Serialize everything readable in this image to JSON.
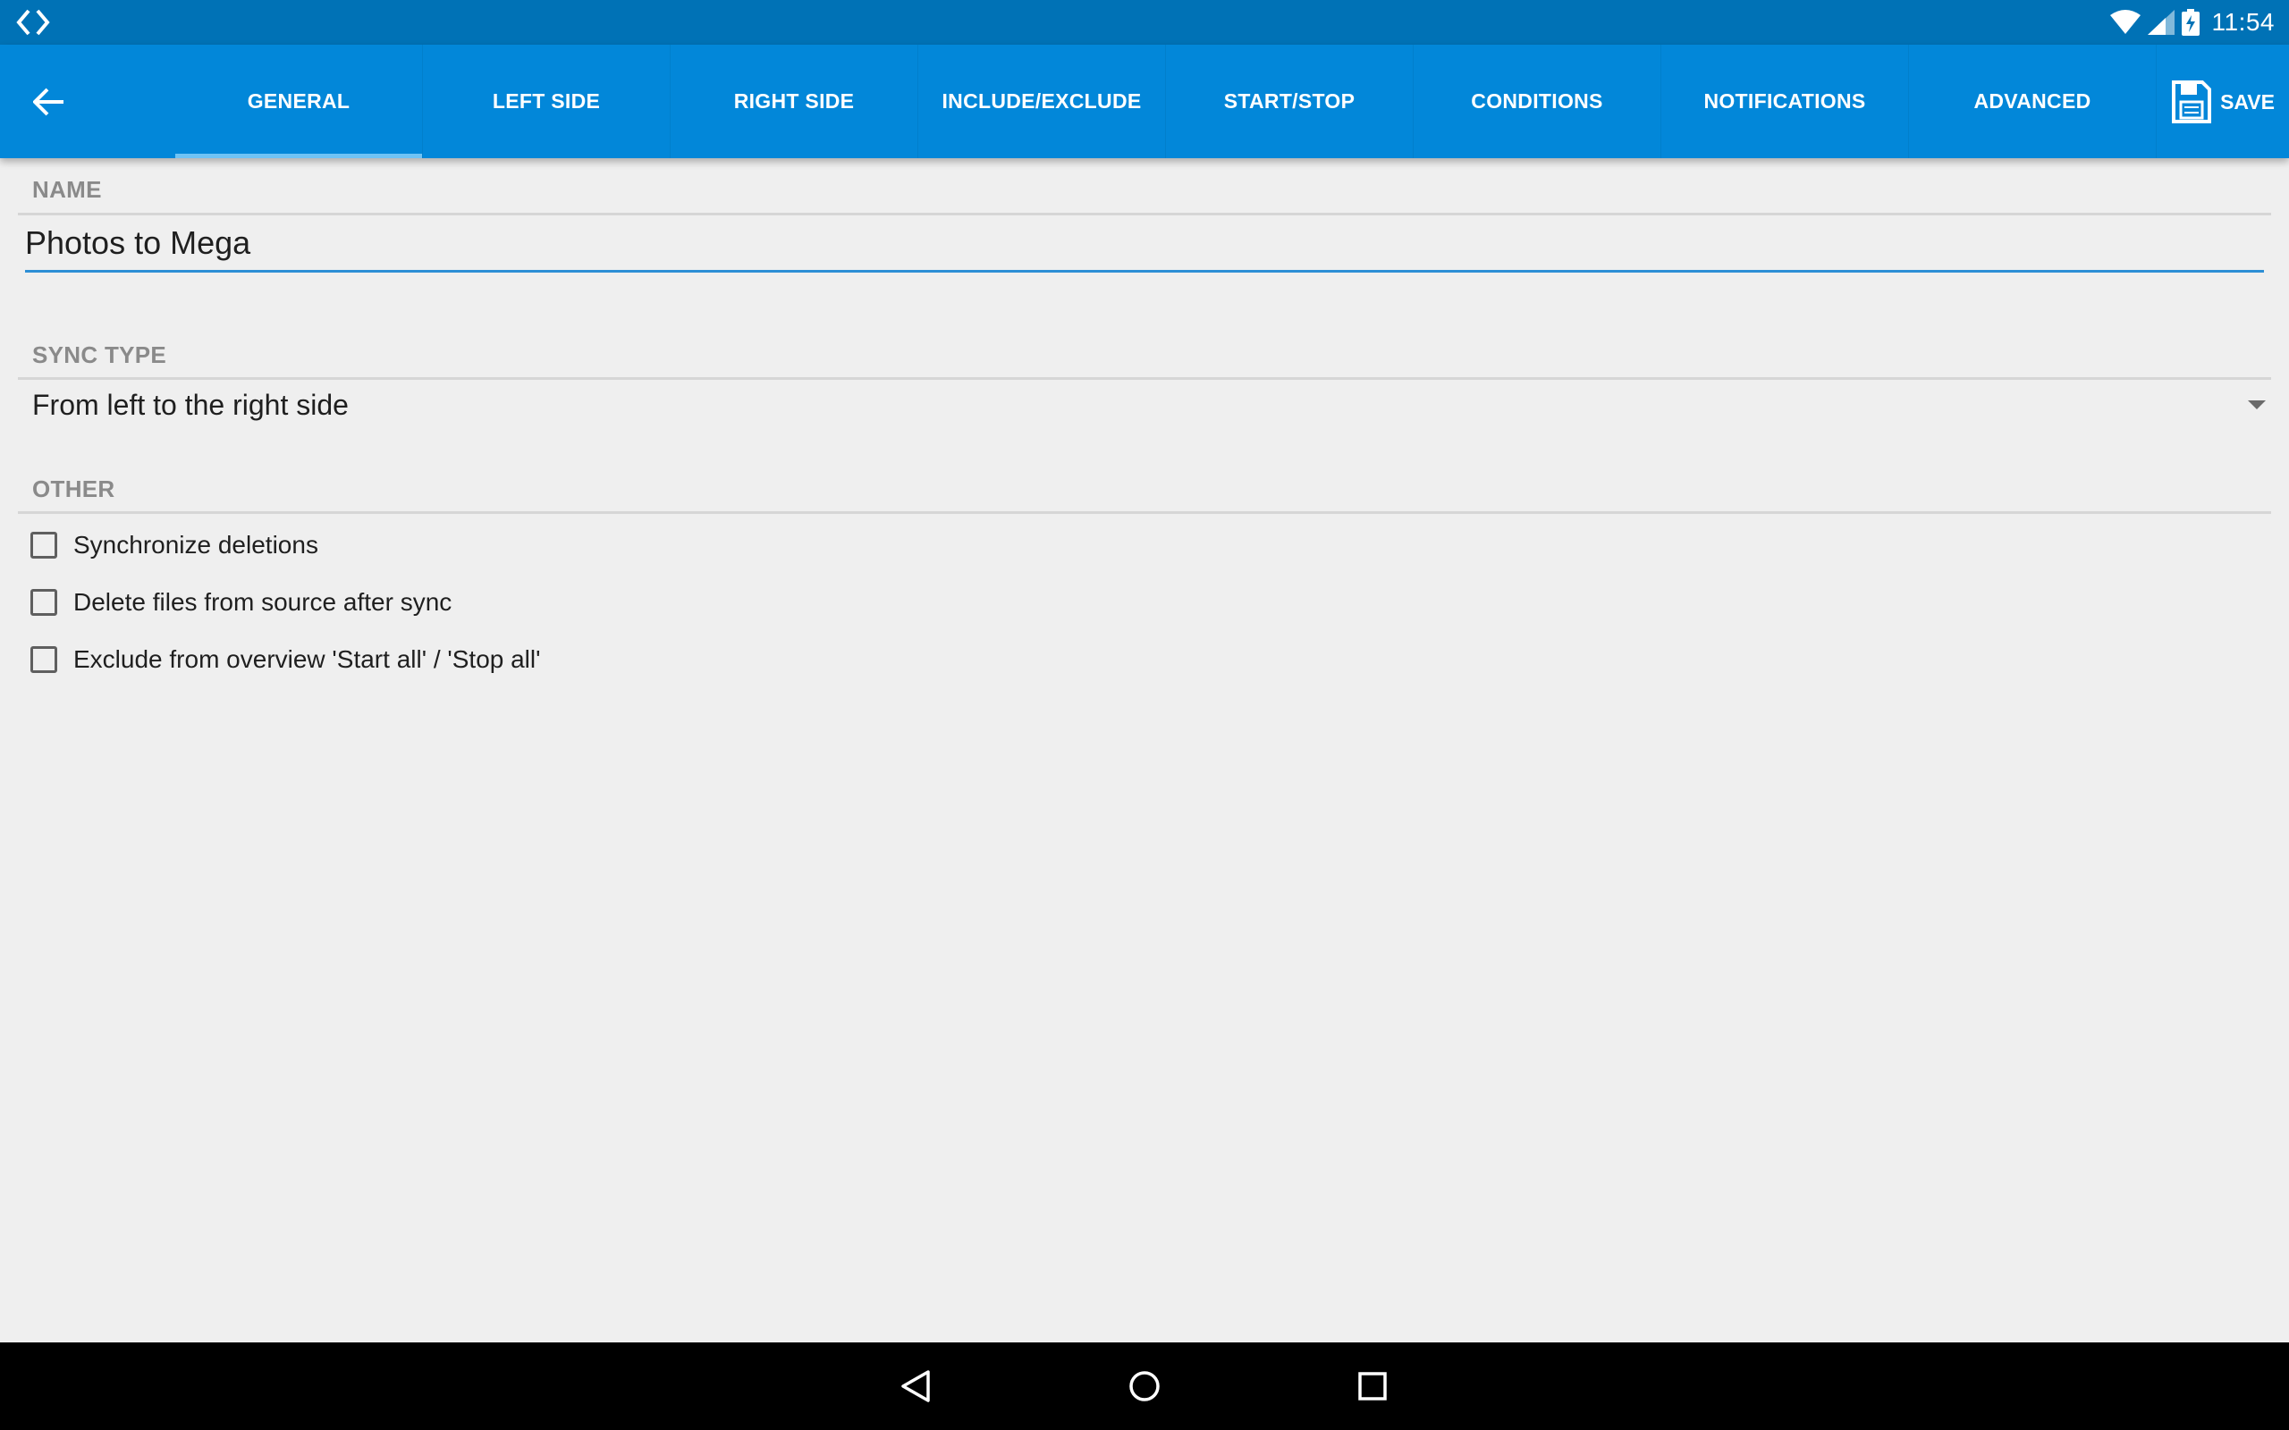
{
  "status_bar": {
    "time": "11:54",
    "icons": [
      "app-icon",
      "wifi-icon",
      "signal-icon",
      "battery-charging-icon"
    ]
  },
  "toolbar": {
    "back_icon": "arrow-back-icon",
    "tabs": [
      {
        "label": "GENERAL",
        "active": true
      },
      {
        "label": "LEFT SIDE",
        "active": false
      },
      {
        "label": "RIGHT SIDE",
        "active": false
      },
      {
        "label": "INCLUDE/EXCLUDE",
        "active": false
      },
      {
        "label": "START/STOP",
        "active": false
      },
      {
        "label": "CONDITIONS",
        "active": false
      },
      {
        "label": "NOTIFICATIONS",
        "active": false
      },
      {
        "label": "ADVANCED",
        "active": false
      }
    ],
    "save_label": "SAVE",
    "save_icon": "floppy-disk-icon"
  },
  "general": {
    "name": {
      "label": "NAME",
      "value": "Photos to Mega"
    },
    "sync_type": {
      "label": "SYNC TYPE",
      "selected": "From left to the right side"
    },
    "other": {
      "label": "OTHER",
      "options": [
        {
          "label": "Synchronize deletions",
          "checked": false
        },
        {
          "label": "Delete files from source after sync",
          "checked": false
        },
        {
          "label": "Exclude from overview 'Start all' / 'Stop all'",
          "checked": false
        }
      ]
    }
  },
  "nav_bar": {
    "buttons": [
      "back-triangle-icon",
      "home-circle-icon",
      "recents-square-icon"
    ]
  },
  "colors": {
    "status_bar": "#0072b6",
    "toolbar": "#0287d9",
    "accent": "#2d8fd5",
    "background": "#efefef"
  }
}
